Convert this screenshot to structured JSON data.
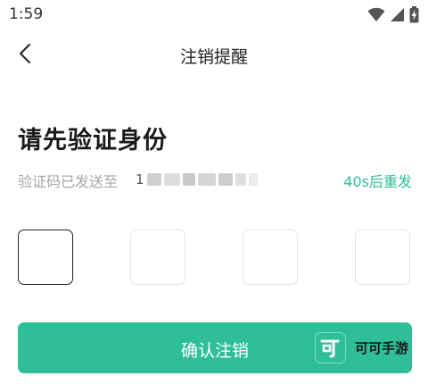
{
  "status_bar": {
    "time": "1:59",
    "icons": [
      "wifi-icon",
      "signal-icon",
      "battery-charging-icon"
    ]
  },
  "nav": {
    "back_icon": "chevron-left-icon",
    "title": "注销提醒"
  },
  "verify": {
    "heading": "请先验证身份",
    "sent_label": "验证码已发送至",
    "phone_masked": "1",
    "resend_label": "40s后重发",
    "code_boxes": [
      "",
      "",
      "",
      ""
    ],
    "active_box_index": 0
  },
  "confirm": {
    "label": "确认注销"
  },
  "watermark": {
    "logo_glyph": "可",
    "text": "可可手游"
  },
  "colors": {
    "accent": "#2ebf98",
    "resend": "#2cbf98",
    "muted_text": "#a7a7a7",
    "box_border": "#e4e4e4",
    "active_border": "#222222"
  }
}
